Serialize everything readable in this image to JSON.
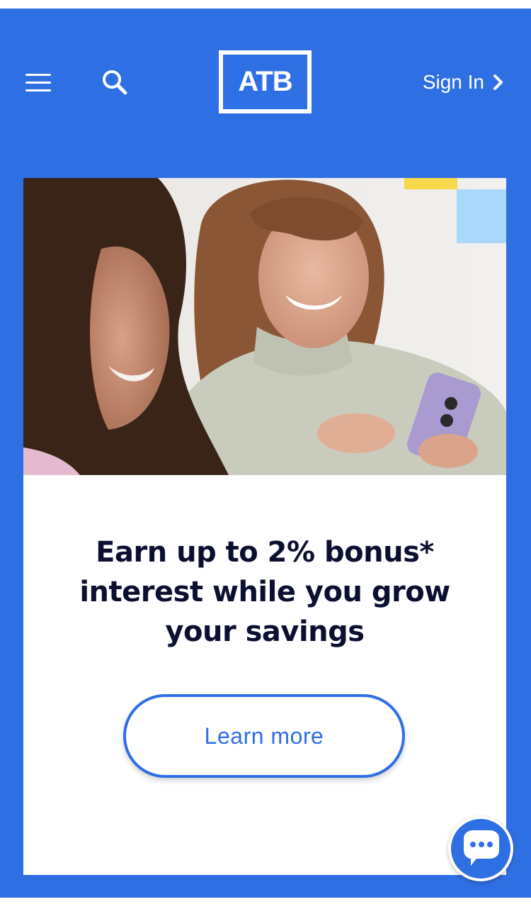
{
  "header": {
    "menu_icon": "hamburger-menu-icon",
    "search_icon": "search-icon",
    "logo_text": "ATB",
    "signin_label": "Sign In",
    "signin_icon": "chevron-right-icon"
  },
  "promo": {
    "headline": "Earn up to 2% bonus* interest while you grow your savings",
    "button_label": "Learn more"
  },
  "chat": {
    "icon": "chat-bubble-icon"
  },
  "colors": {
    "brand_blue": "#2f6fe4",
    "headline_text": "#0c1030",
    "accent_yellow": "#f7d84a",
    "accent_light_blue": "#a9d8fb"
  }
}
